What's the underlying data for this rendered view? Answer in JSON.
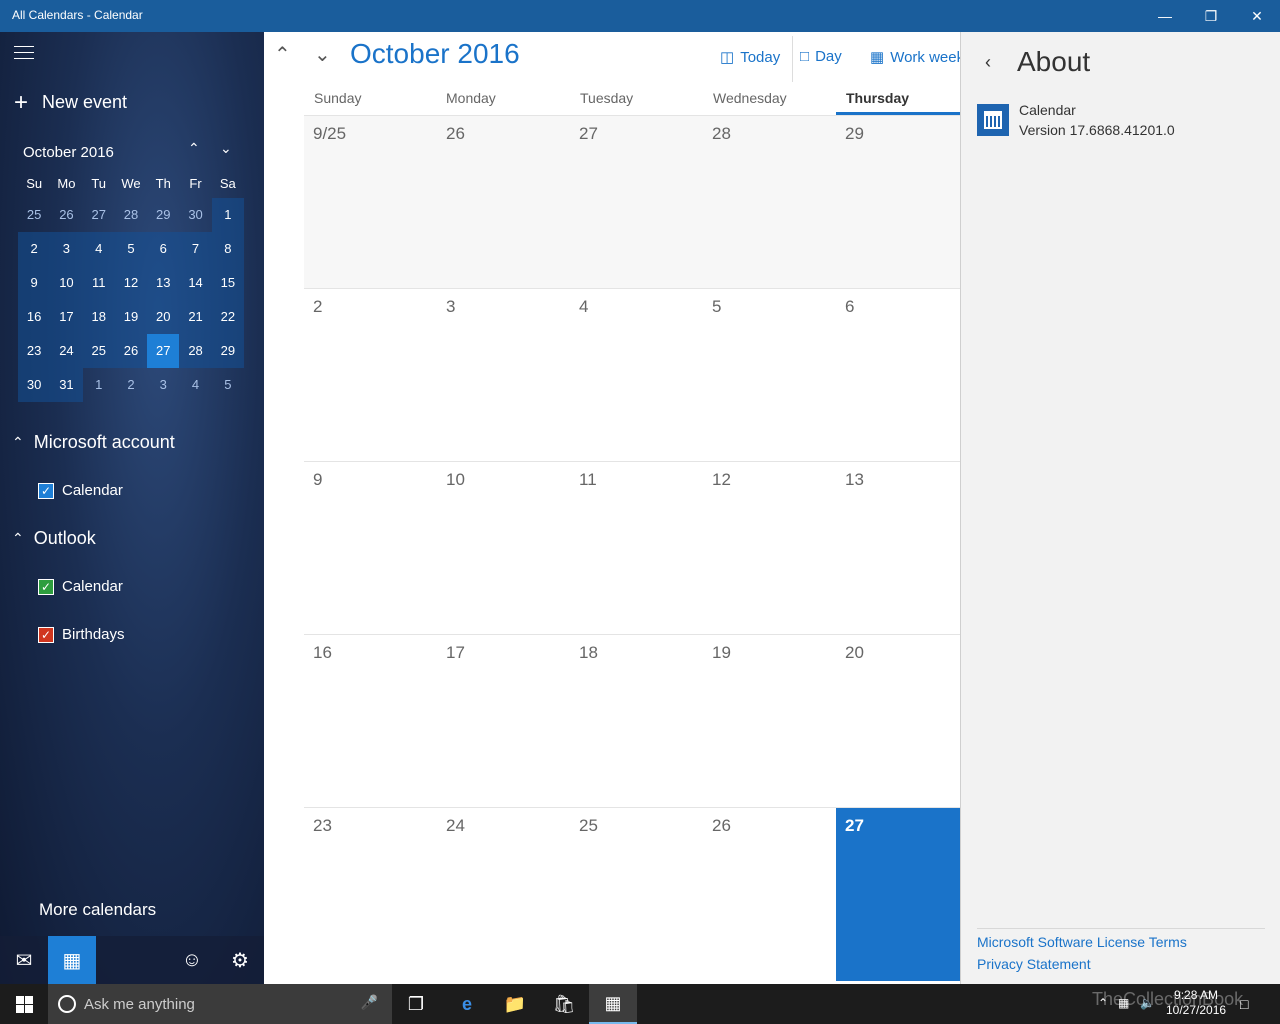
{
  "window": {
    "title": "All Calendars - Calendar",
    "minimize": "—",
    "restore": "❐",
    "close": "✕"
  },
  "sidebar": {
    "new_event_label": "New event",
    "mini_calendar": {
      "title": "October 2016",
      "weekdays": [
        "Su",
        "Mo",
        "Tu",
        "We",
        "Th",
        "Fr",
        "Sa"
      ],
      "weeks": [
        [
          "25",
          "26",
          "27",
          "28",
          "29",
          "30",
          "1"
        ],
        [
          "2",
          "3",
          "4",
          "5",
          "6",
          "7",
          "8"
        ],
        [
          "9",
          "10",
          "11",
          "12",
          "13",
          "14",
          "15"
        ],
        [
          "16",
          "17",
          "18",
          "19",
          "20",
          "21",
          "22"
        ],
        [
          "23",
          "24",
          "25",
          "26",
          "27",
          "28",
          "29"
        ],
        [
          "30",
          "31",
          "1",
          "2",
          "3",
          "4",
          "5"
        ]
      ]
    },
    "accounts": [
      {
        "name": "Microsoft account",
        "calendars": [
          {
            "label": "Calendar",
            "color": "#1e7fd6"
          }
        ]
      },
      {
        "name": "Outlook",
        "calendars": [
          {
            "label": "Calendar",
            "color": "#2e9e3e"
          },
          {
            "label": "Birthdays",
            "color": "#d0361f"
          }
        ]
      }
    ],
    "more_calendars_label": "More calendars",
    "bottom_icons": [
      "mail-icon",
      "calendar-icon",
      "smiley-icon",
      "settings-icon"
    ]
  },
  "main": {
    "month_title": "October 2016",
    "toolbar": {
      "today_label": "Today",
      "day_label": "Day",
      "work_week_label": "Work week"
    },
    "day_headers": [
      "Sunday",
      "Monday",
      "Tuesday",
      "Wednesday",
      "Thursday"
    ],
    "weeks": [
      [
        "9/25",
        "26",
        "27",
        "28",
        "29"
      ],
      [
        "2",
        "3",
        "4",
        "5",
        "6"
      ],
      [
        "9",
        "10",
        "11",
        "12",
        "13"
      ],
      [
        "16",
        "17",
        "18",
        "19",
        "20"
      ],
      [
        "23",
        "24",
        "25",
        "26",
        "27"
      ]
    ]
  },
  "about": {
    "title": "About",
    "app_name": "Calendar",
    "version": "Version 17.6868.41201.0",
    "license_link": "Microsoft Software License Terms",
    "privacy_link": "Privacy Statement"
  },
  "taskbar": {
    "search_placeholder": "Ask me anything",
    "time": "9:28 AM",
    "date": "10/27/2016",
    "watermark": "TheCollectionBook"
  },
  "colors": {
    "accent": "#1a73c9",
    "titlebar": "#1a5d9c",
    "today": "#1e7fd6"
  }
}
